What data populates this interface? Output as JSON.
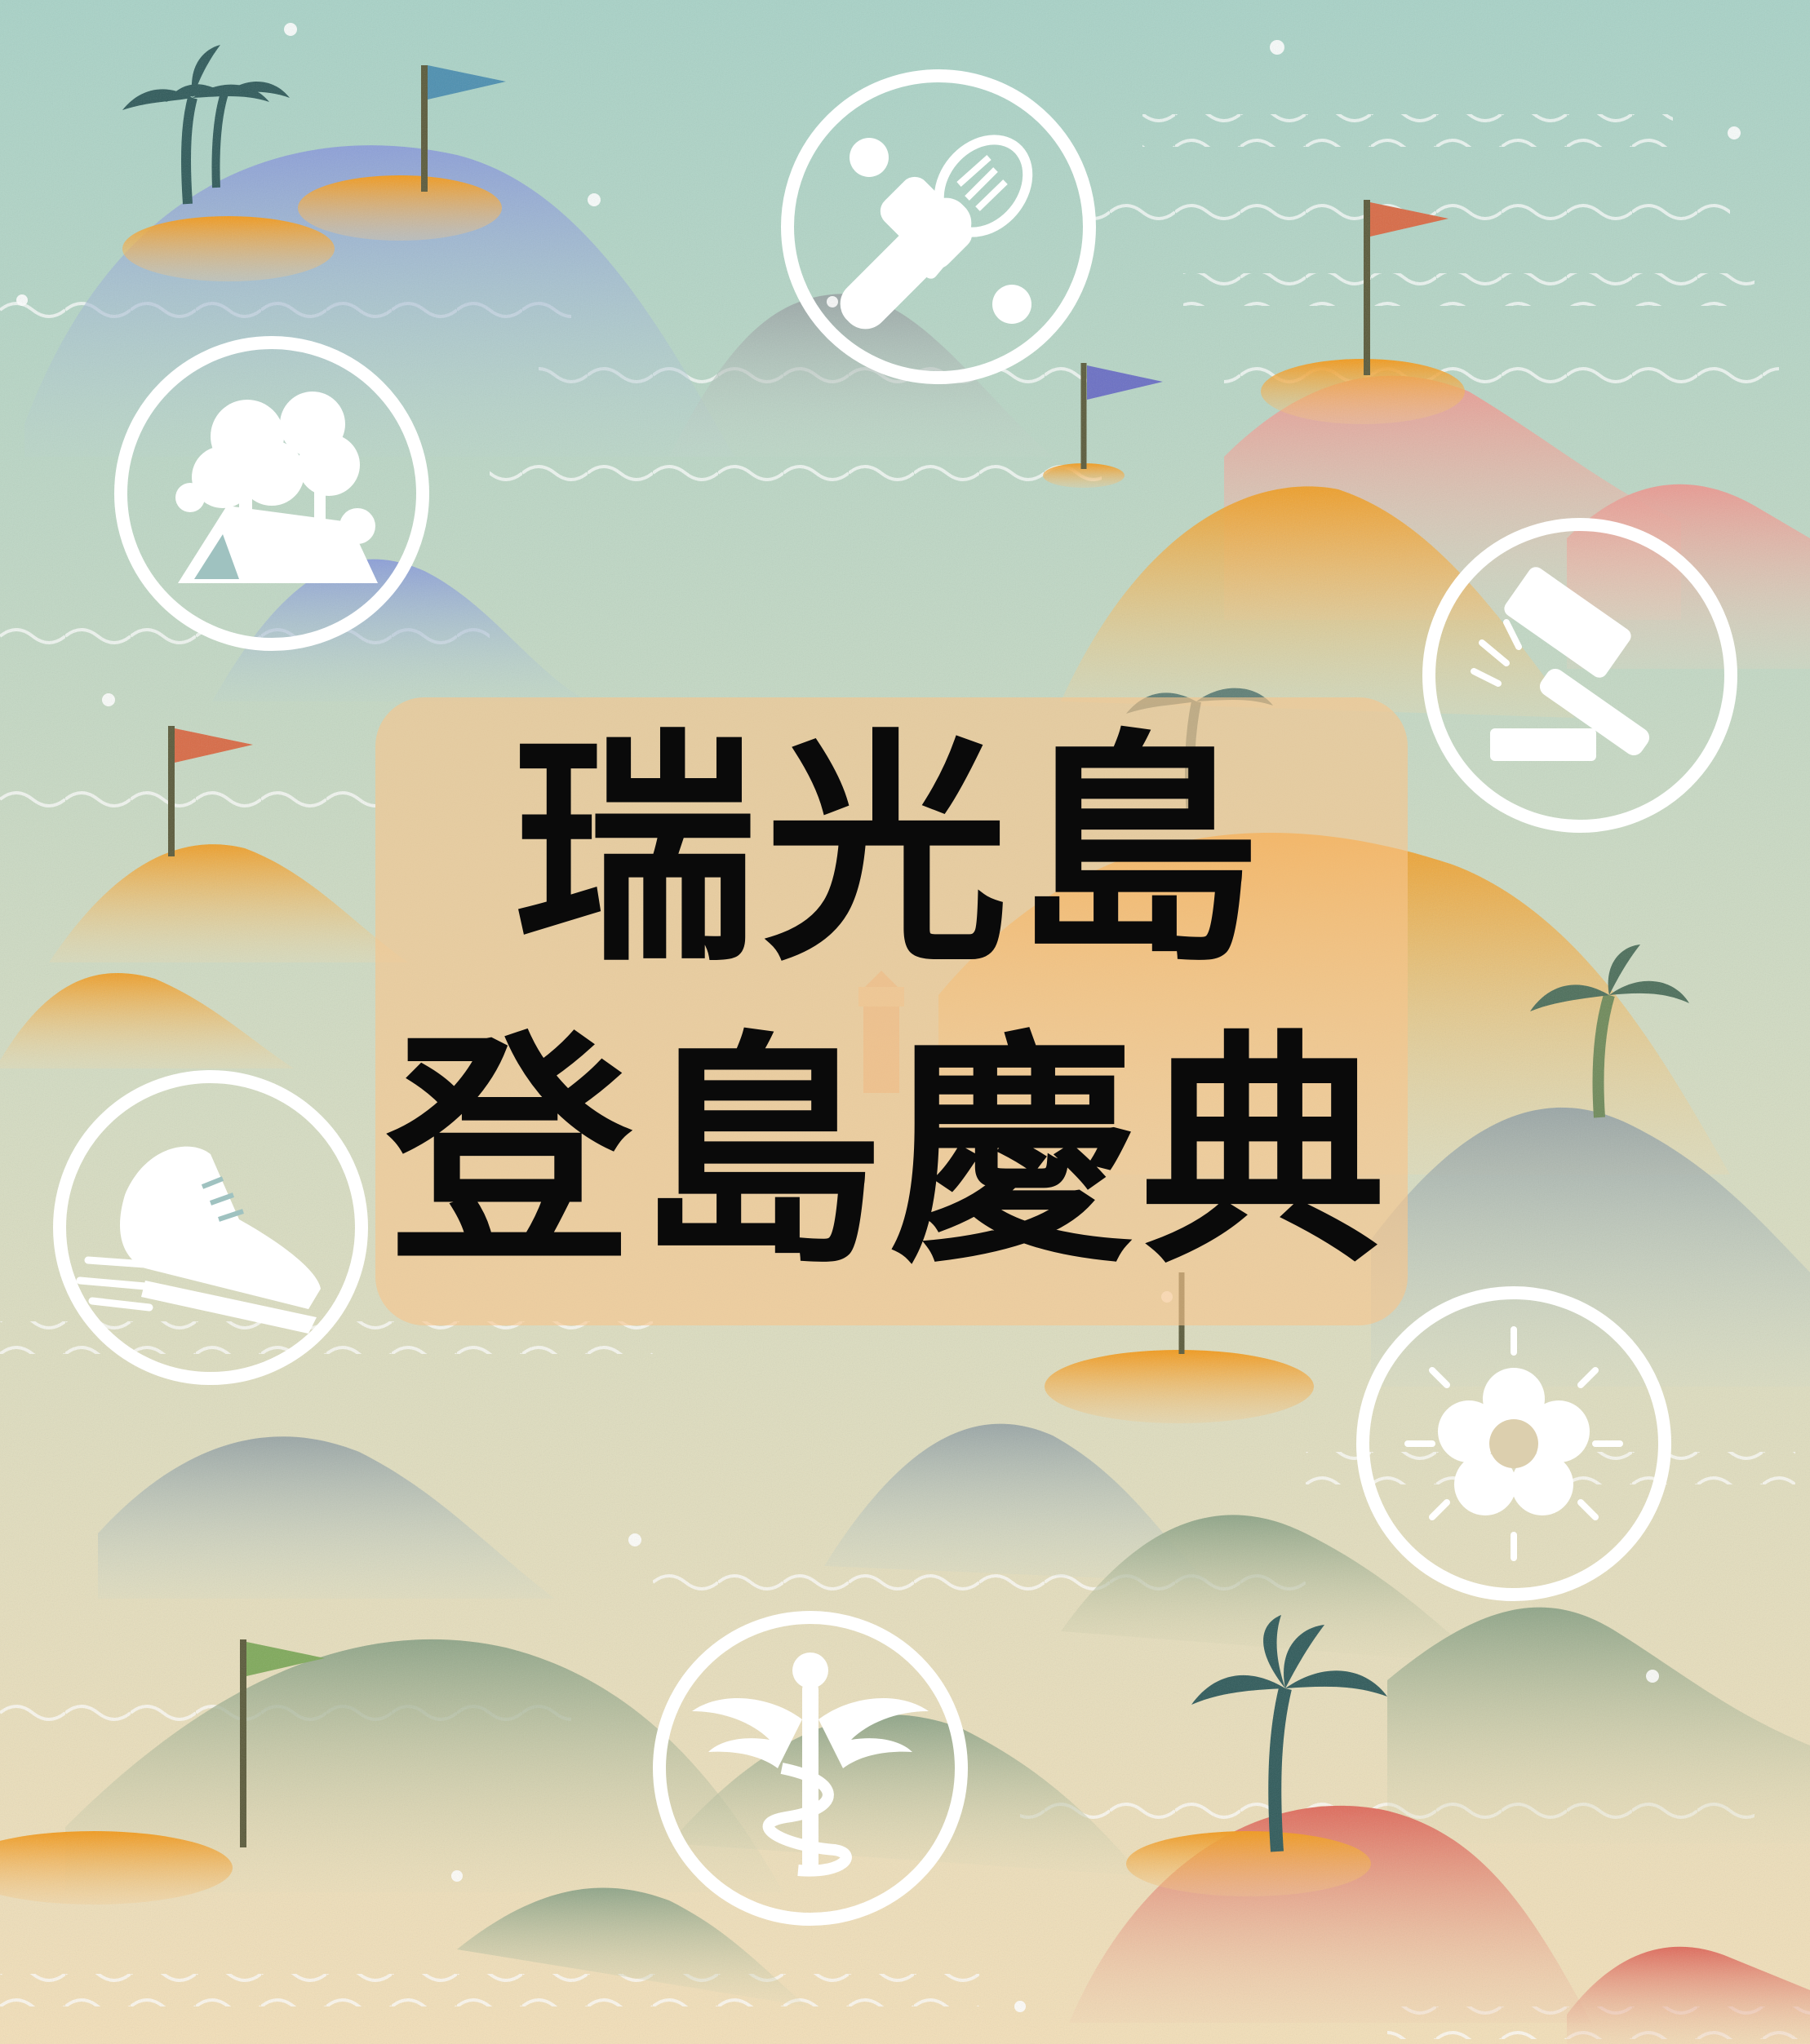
{
  "poster": {
    "title_line_1": "瑞光島",
    "title_line_2": "登島慶典"
  },
  "colors": {
    "sea_top": "#a8d2c7",
    "sea_bottom": "#f3dfb8",
    "title_card": "#f7c58c",
    "title_text": "#0a0a0a",
    "icon_ring": "#ffffff",
    "island_orange": "#f29a1c",
    "flag_red": "#d86a45",
    "flag_blue": "#4c8fb0",
    "flag_purple": "#6a6fc4",
    "flag_green": "#7fa95a",
    "palm": "#2f5a5a"
  },
  "badges": [
    {
      "id": "baking",
      "icon": "rolling-pin-whisk-icon"
    },
    {
      "id": "camping",
      "icon": "camping-tent-trees-icon"
    },
    {
      "id": "auction",
      "icon": "gavel-icon"
    },
    {
      "id": "running",
      "icon": "running-shoe-icon"
    },
    {
      "id": "nature",
      "icon": "flower-sun-icon"
    },
    {
      "id": "medical",
      "icon": "caduceus-icon"
    }
  ]
}
